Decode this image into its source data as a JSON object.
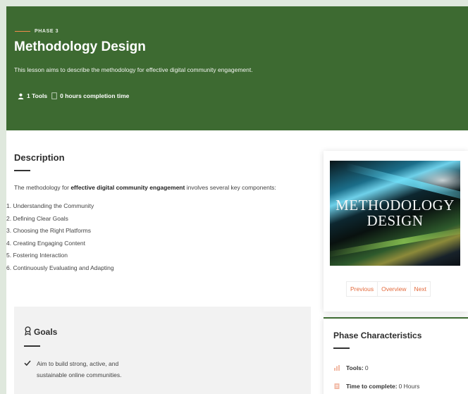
{
  "hero": {
    "phase_label": "PHASE 3",
    "title": "Methodology Design",
    "description": "This lesson aims to describe the methodology for effective digital community engagement.",
    "tools": "1 Tools",
    "completion": "0 hours completion time"
  },
  "description": {
    "title": "Description",
    "intro_prefix": "The methodology for ",
    "intro_bold": "effective digital community engagement",
    "intro_suffix": " involves several key components:",
    "steps": [
      "1. Understanding the Community",
      "2. Defining Clear Goals",
      "3. Choosing the Right Platforms",
      "4. Creating Engaging Content",
      "5. Fostering Interaction",
      "6. Continuously Evaluating and Adapting"
    ]
  },
  "goals": {
    "title": "Goals",
    "items": [
      "Aim to build strong, active, and sustainable online communities."
    ]
  },
  "card": {
    "image_text_line1": "METHODOLOGY",
    "image_text_line2": "DESIGN",
    "previous_label": "Previous",
    "overview_label": "Overview",
    "next_label": "Next"
  },
  "phase_characteristics": {
    "title": "Phase Characteristics",
    "tools_label": "Tools:",
    "tools_value": "0",
    "time_label": "Time to complete:",
    "time_value": "0 Hours"
  },
  "colors": {
    "hero_bg": "#3d6a31",
    "accent_orange": "#e36a3c",
    "page_bg": "#dfe8dd"
  }
}
